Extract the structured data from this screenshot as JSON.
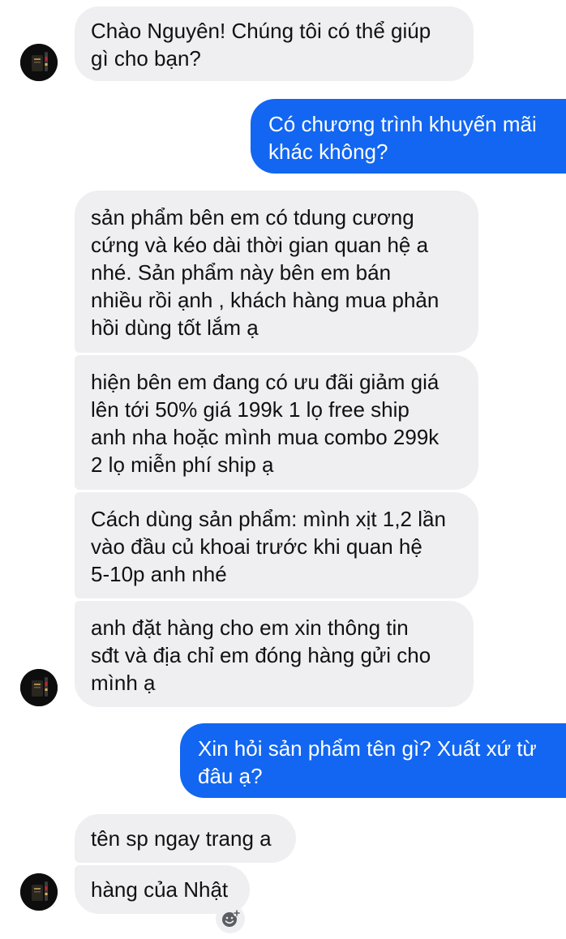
{
  "conversation": {
    "messages": [
      {
        "id": "m1",
        "sender": "shop",
        "text": "Chào Nguyên! Chúng tôi có thể giúp\ngì cho bạn?"
      },
      {
        "id": "m2",
        "sender": "user",
        "text": "Có chương trình khuyến mãi\nkhác không?"
      },
      {
        "id": "m3",
        "sender": "shop",
        "text": "sản phẩm bên em có tdung cương\ncứng và kéo dài thời gian quan hệ a\nnhé. Sản phẩm này bên em bán\nnhiều rồi ạnh , khách hàng mua phản\nhồi dùng tốt lắm ạ"
      },
      {
        "id": "m4",
        "sender": "shop",
        "text": "hiện bên em đang có ưu đãi giảm giá\nlên tới 50% giá 199k 1 lọ free ship\nanh nha hoặc mình mua combo 299k\n2 lọ miễn phí ship ạ"
      },
      {
        "id": "m5",
        "sender": "shop",
        "text": "Cách dùng sản phẩm: mình xịt 1,2 lần\nvào đầu củ khoai trước khi quan hệ\n5-10p anh nhé"
      },
      {
        "id": "m6",
        "sender": "shop",
        "text": "anh đặt hàng cho em xin thông tin\nsđt và địa chỉ em đóng hàng gửi cho\nmình ạ"
      },
      {
        "id": "m7",
        "sender": "user",
        "text": "Xin hỏi sản phẩm tên gì? Xuất xứ từ\nđâu ạ?"
      },
      {
        "id": "m8",
        "sender": "shop",
        "text": "tên sp ngay trang a"
      },
      {
        "id": "m9",
        "sender": "shop",
        "text": "hàng của Nhật"
      }
    ]
  },
  "colors": {
    "outgoing_bubble": "#1266f1",
    "incoming_bubble": "#efeff2",
    "incoming_text": "#111111",
    "outgoing_text": "#ffffff"
  },
  "icons": {
    "avatar": "shop-avatar-icon",
    "reaction": "add-reaction-icon"
  }
}
